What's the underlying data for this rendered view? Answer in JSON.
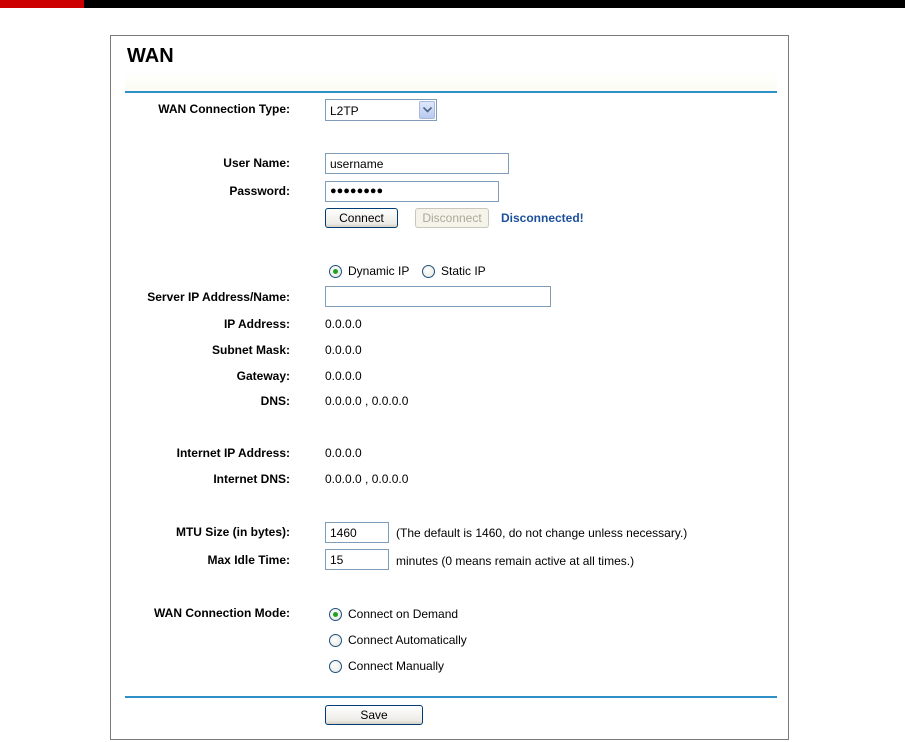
{
  "page": {
    "title": "WAN"
  },
  "wan": {
    "connection_type_label": "WAN Connection Type:",
    "connection_type_value": "L2TP",
    "user_name_label": "User Name:",
    "user_name_value": "username",
    "password_label": "Password:",
    "password_value": "●●●●●●●●",
    "connect_label": "Connect",
    "disconnect_label": "Disconnect",
    "status": "Disconnected!",
    "dynamic_ip_label": "Dynamic IP",
    "static_ip_label": "Static IP",
    "ip_mode_selected": "Dynamic IP",
    "server_label": "Server IP Address/Name:",
    "server_value": "",
    "ip_label": "IP Address:",
    "ip_value": "0.0.0.0",
    "subnet_label": "Subnet Mask:",
    "subnet_value": "0.0.0.0",
    "gateway_label": "Gateway:",
    "gateway_value": "0.0.0.0",
    "dns_label": "DNS:",
    "dns_value": "0.0.0.0 , 0.0.0.0",
    "internet_ip_label": "Internet IP Address:",
    "internet_ip_value": "0.0.0.0",
    "internet_dns_label": "Internet DNS:",
    "internet_dns_value": "0.0.0.0 , 0.0.0.0",
    "mtu_label": "MTU Size (in bytes):",
    "mtu_value": "1460",
    "mtu_hint": "(The default is 1460, do not change unless necessary.)",
    "idle_label": "Max Idle Time:",
    "idle_value": "15",
    "idle_hint": "minutes (0 means remain active at all times.)",
    "mode_label": "WAN Connection Mode:",
    "mode_options": [
      "Connect on Demand",
      "Connect Automatically",
      "Connect Manually"
    ],
    "mode_selected": "Connect on Demand",
    "save_label": "Save"
  },
  "colors": {
    "accent_rule": "#2f8fc7",
    "status": "#1c4f9c",
    "brand_red": "#cc0000"
  }
}
